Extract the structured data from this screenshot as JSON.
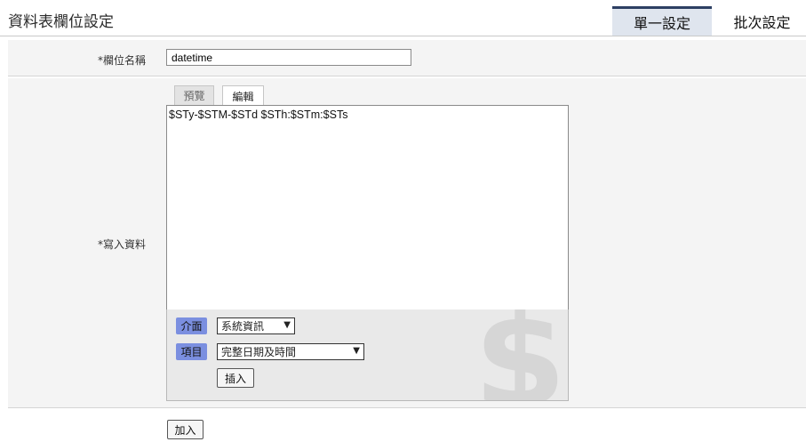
{
  "header": {
    "title": "資料表欄位設定",
    "tabs": [
      {
        "label": "單一設定",
        "active": true
      },
      {
        "label": "批次設定",
        "active": false
      }
    ]
  },
  "form": {
    "name_label": "*欄位名稱",
    "name_value": "datetime",
    "data_label": "*寫入資料",
    "editor_tabs": [
      {
        "label": "預覽",
        "active": false
      },
      {
        "label": "編輯",
        "active": true
      }
    ],
    "editor_content": "$STy-$STM-$STd $STh:$STm:$STs",
    "interface_label": "介面",
    "interface_selected": "系統資訊",
    "item_label": "項目",
    "item_selected": "完整日期及時間",
    "insert_button": "插入",
    "watermark": "$"
  },
  "add_button": "加入",
  "colors": {
    "accent": "#2d3f63",
    "chip": "#7b8fe0",
    "row_bg": "#f4f4f4"
  }
}
